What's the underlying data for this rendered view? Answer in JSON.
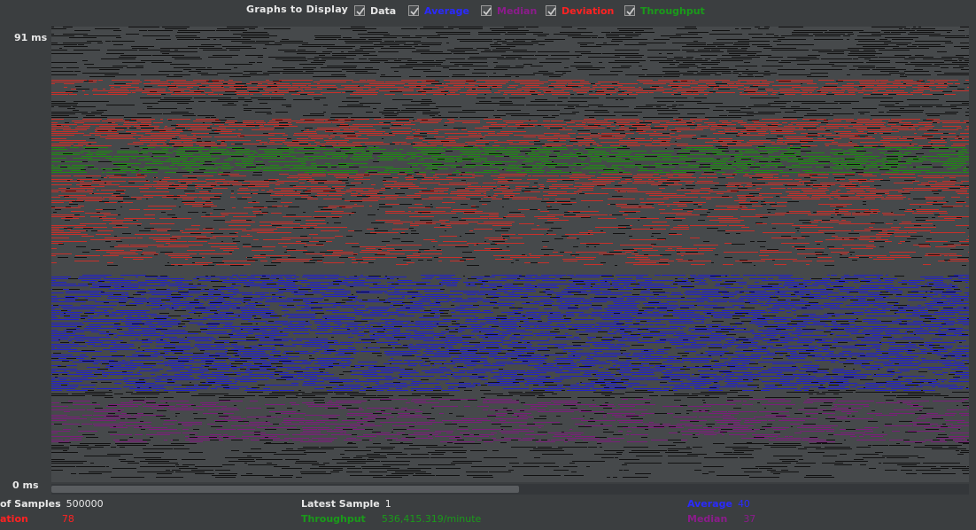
{
  "toolbar": {
    "title": "Graphs to Display",
    "options": [
      {
        "label": "Data",
        "checked": true,
        "color": "#e6e6e6"
      },
      {
        "label": "Average",
        "checked": true,
        "color": "#2a2aff"
      },
      {
        "label": "Median",
        "checked": true,
        "color": "#8b1c8b"
      },
      {
        "label": "Deviation",
        "checked": true,
        "color": "#ff2222"
      },
      {
        "label": "Throughput",
        "checked": true,
        "color": "#1a9a1a"
      }
    ]
  },
  "chart_data": {
    "type": "line",
    "y_max_label": "91 ms",
    "y_min_label": "0 ms",
    "ylim": [
      0,
      91
    ],
    "series": [
      {
        "name": "Data",
        "color": "#111111"
      },
      {
        "name": "Average",
        "color": "#2323c8"
      },
      {
        "name": "Median",
        "color": "#7a1f7a"
      },
      {
        "name": "Deviation",
        "color": "#c8302a"
      },
      {
        "name": "Throughput",
        "color": "#1f8a12"
      }
    ]
  },
  "stats": {
    "samples_label": "of Samples",
    "samples_value": "500000",
    "deviation_label": "ation",
    "deviation_value": "78",
    "latest_label": "Latest Sample",
    "latest_value": "1",
    "throughput_label": "Throughput",
    "throughput_value": "536,415.319/minute",
    "average_label": "Average",
    "average_value": "40",
    "median_label": "Median",
    "median_value": "37"
  },
  "scroll": {
    "position": 0.0,
    "visible_fraction": 0.51
  }
}
